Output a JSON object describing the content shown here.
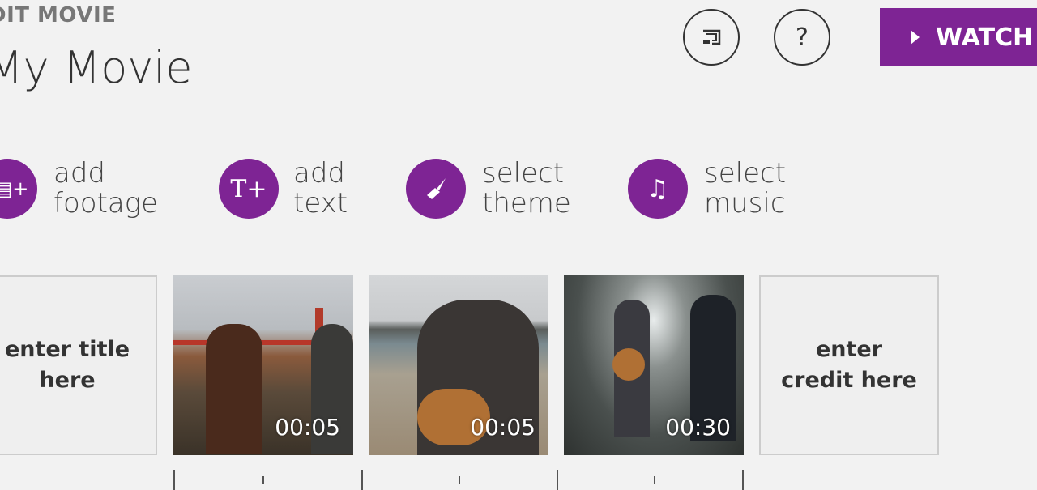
{
  "header": {
    "subtitle": "DIT MOVIE",
    "title": "My Movie"
  },
  "toolbar": {
    "cast_icon": "cast-icon",
    "help_label": "?",
    "watch_label": "WATCH",
    "accent": "#7e2494"
  },
  "actions": [
    {
      "line1": "add",
      "line2": "footage",
      "icon": "add-footage-icon",
      "glyph": "▤+"
    },
    {
      "line1": "add",
      "line2": "text",
      "icon": "add-text-icon",
      "glyph": "T+"
    },
    {
      "line1": "select",
      "line2": "theme",
      "icon": "paintbrush-icon",
      "glyph": "🖌"
    },
    {
      "line1": "select",
      "line2": "music",
      "icon": "music-note-icon",
      "glyph": "♫"
    }
  ],
  "timeline": {
    "title_card": "enter title here",
    "clips": [
      {
        "duration": "00:05"
      },
      {
        "duration": "00:05"
      },
      {
        "duration": "00:30"
      }
    ],
    "credit_card": "enter credit here"
  }
}
